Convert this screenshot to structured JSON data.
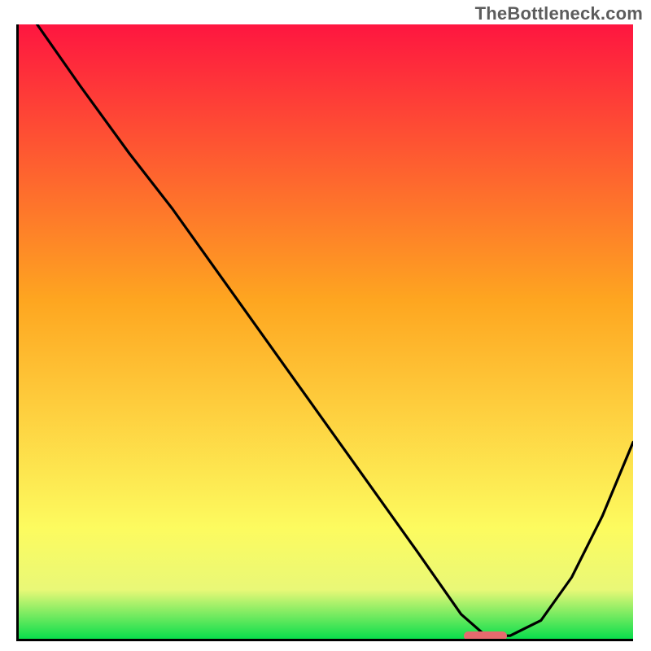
{
  "watermark": "TheBottleneck.com",
  "colors": {
    "gradient_top": "#fe1640",
    "gradient_mid": "#fea620",
    "gradient_low1": "#fdfb5f",
    "gradient_low2": "#e9f877",
    "gradient_bottom": "#0ade4c",
    "curve": "#000000",
    "marker": "#e66a6e",
    "axes": "#000000"
  },
  "chart_data": {
    "type": "line",
    "title": "",
    "xlabel": "",
    "ylabel": "",
    "xlim": [
      0,
      100
    ],
    "ylim": [
      0,
      100
    ],
    "grid": false,
    "series": [
      {
        "name": "curve",
        "x_note": "x as percent of plot width (0=left axis, 100=right edge)",
        "y_note": "y as percent of plot height (0=bottom axis, 100=top)",
        "x": [
          3,
          10,
          18,
          25,
          35,
          45,
          55,
          65,
          72,
          76,
          80,
          85,
          90,
          95,
          100
        ],
        "y": [
          100,
          90,
          79,
          70,
          56,
          42,
          28,
          14,
          4,
          0.5,
          0.5,
          3,
          10,
          20,
          32
        ]
      }
    ],
    "marker": {
      "x_pct": 76,
      "y_pct": 0.5,
      "width_pct": 7,
      "height_pct": 1.5
    },
    "background_gradient_stops": [
      {
        "pos": 0.0,
        "color": "#fe1640"
      },
      {
        "pos": 0.45,
        "color": "#fea620"
      },
      {
        "pos": 0.82,
        "color": "#fdfb5f"
      },
      {
        "pos": 0.92,
        "color": "#e9f877"
      },
      {
        "pos": 1.0,
        "color": "#0ade4c"
      }
    ]
  }
}
